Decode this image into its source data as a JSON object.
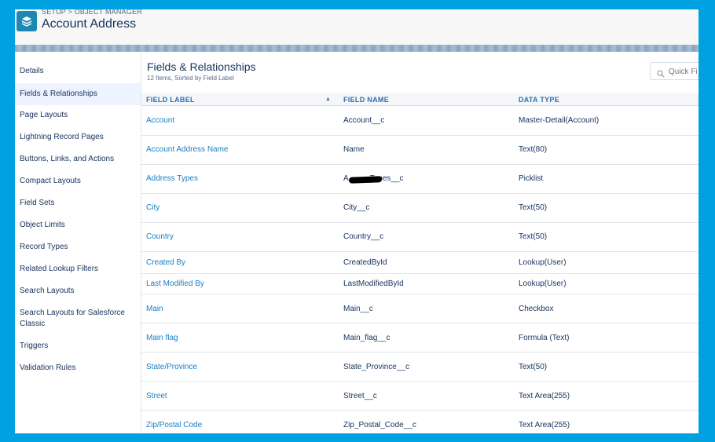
{
  "header": {
    "breadcrumb": "SETUP > OBJECT MANAGER",
    "title": "Account Address",
    "icon": "layers-icon"
  },
  "sidebar": {
    "items": [
      {
        "label": "Details"
      },
      {
        "label": "Fields & Relationships",
        "active": true
      },
      {
        "label": "Page Layouts"
      },
      {
        "label": "Lightning Record Pages"
      },
      {
        "label": "Buttons, Links, and Actions"
      },
      {
        "label": "Compact Layouts"
      },
      {
        "label": "Field Sets"
      },
      {
        "label": "Object Limits"
      },
      {
        "label": "Record Types"
      },
      {
        "label": "Related Lookup Filters"
      },
      {
        "label": "Search Layouts"
      },
      {
        "label": "Search Layouts for Salesforce Classic"
      },
      {
        "label": "Triggers"
      },
      {
        "label": "Validation Rules"
      }
    ]
  },
  "main": {
    "title": "Fields & Relationships",
    "subtitle": "12 Items, Sorted by Field Label",
    "quick_find": {
      "placeholder": "Quick Fi",
      "icon": "search-icon"
    },
    "columns": [
      "FIELD LABEL",
      "FIELD NAME",
      "DATA TYPE"
    ],
    "rows": [
      {
        "label": "Account",
        "name": "Account__c",
        "type": "Master-Detail(Account)"
      },
      {
        "label": "Account Address Name",
        "name": "Name",
        "type": "Text(80)"
      },
      {
        "label": "Address Types",
        "name": "A          Types__c",
        "type": "Picklist",
        "redacted": true
      },
      {
        "label": "City",
        "name": "City__c",
        "type": "Text(50)"
      },
      {
        "label": "Country",
        "name": "Country__c",
        "type": "Text(50)"
      },
      {
        "label": "Created By",
        "name": "CreatedById",
        "type": "Lookup(User)"
      },
      {
        "label": "Last Modified By",
        "name": "LastModifiedById",
        "type": "Lookup(User)"
      },
      {
        "label": "Main",
        "name": "Main__c",
        "type": "Checkbox"
      },
      {
        "label": "Main flag",
        "name": "Main_flag__c",
        "type": "Formula (Text)"
      },
      {
        "label": "State/Province",
        "name": "State_Province__c",
        "type": "Text(50)"
      },
      {
        "label": "Street",
        "name": "Street__c",
        "type": "Text Area(255)"
      },
      {
        "label": "Zip/Postal Code",
        "name": "Zip_Postal_Code__c",
        "type": "Text Area(255)"
      }
    ]
  }
}
